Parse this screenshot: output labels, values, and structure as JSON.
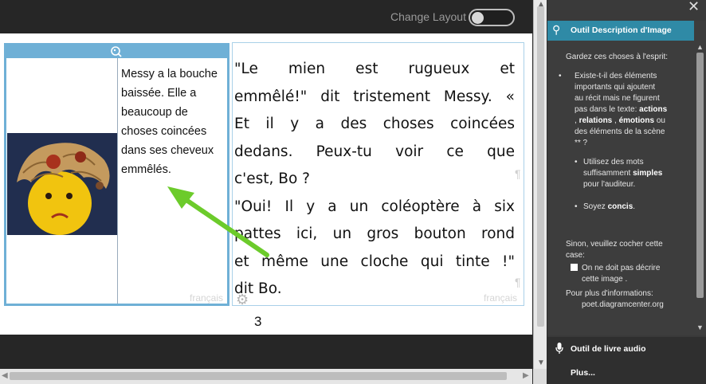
{
  "toolbar": {
    "change_layout_label": "Change Layout"
  },
  "page": {
    "image_description": [
      "Messy a la bouche",
      "baissée. Elle a",
      "beaucoup de",
      "choses coincées",
      "dans ses cheveux",
      "emmêlés."
    ],
    "language_label": "français",
    "story_lines": [
      "\"Le mien est rugueux et",
      "emmêlé!\" dit tristement Messy. «",
      "Et il y a des choses coincées",
      "dedans. Peux-tu voir ce que",
      "c'est, Bo ?",
      "\"Oui! Il y a un coléoptère à six",
      "pattes ici, un gros bouton rond",
      "et même une cloche qui tinte !\"",
      "dit Bo."
    ],
    "pilcrow": "¶",
    "page_number": "3"
  },
  "side_panel": {
    "tool_title": "Outil Description d'Image",
    "keep_in_mind": "Gardez ces choses à l'esprit:",
    "bullet1_lines": [
      "Existe-t-il des éléments",
      "importants qui ajoutent",
      "au récit mais ne figurent",
      "pas dans le texte:"
    ],
    "bullet1_actions": "actions",
    "bullet1_relations": "relations",
    "bullet1_emotions": "émotions",
    "bullet1_ou": "ou",
    "bullet1_tail": "des éléments de la scène",
    "bullet1_end": "** ?",
    "sub1_a": "Utilisez des mots",
    "sub1_b": "suffisamment",
    "sub1_simple": "simples",
    "sub1_c": "pour l'auditeur.",
    "sub2_a": "Soyez",
    "sub2_concis": "concis",
    "sinon": [
      "Sinon, veuillez cocher cette",
      "case:"
    ],
    "checkbox_label": [
      "On ne doit pas décrire",
      "cette image ."
    ],
    "info_title": "Pour plus d'informations:",
    "info_url": "poet.diagramcenter.org",
    "audio_tool": "Outil de livre audio",
    "more": "Plus..."
  }
}
